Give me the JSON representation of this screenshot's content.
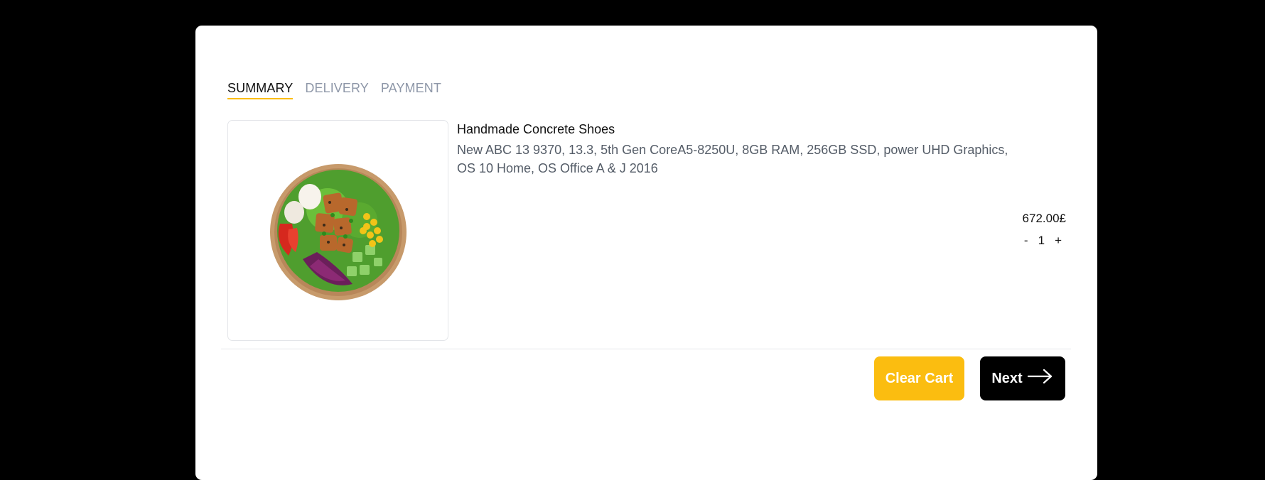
{
  "tabs": [
    {
      "label": "SUMMARY",
      "active": true
    },
    {
      "label": "DELIVERY",
      "active": false
    },
    {
      "label": "PAYMENT",
      "active": false
    }
  ],
  "cart_item": {
    "image_icon": "salad-bowl-image",
    "title": "Handmade Concrete Shoes",
    "description": "New ABC 13 9370, 13.3, 5th Gen CoreA5-8250U, 8GB RAM, 256GB SSD, power UHD Graphics, OS 10 Home, OS Office A & J 2016",
    "price": "672.00£",
    "quantity": {
      "decrement": "-",
      "value": "1",
      "increment": "+"
    }
  },
  "actions": {
    "clear_label": "Clear Cart",
    "next_label": "Next",
    "next_icon": "arrow-right-icon"
  },
  "colors": {
    "accent": "#fbbd10",
    "background": "#000000",
    "card": "#ffffff",
    "muted_tab": "#8e97a8"
  }
}
